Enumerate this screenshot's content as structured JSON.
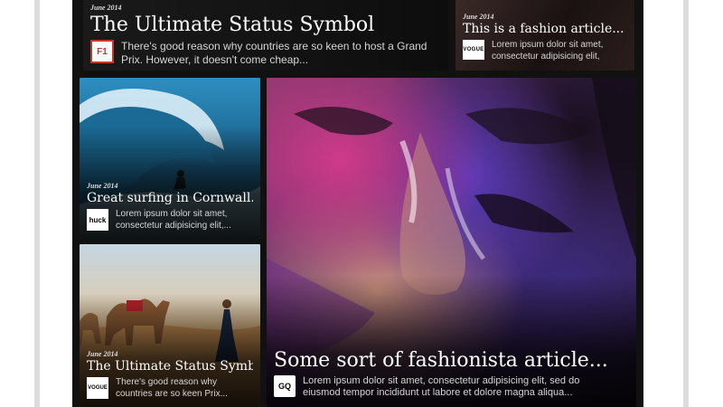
{
  "cards": [
    {
      "id": "c1",
      "date": "June 2014",
      "title": "The Ultimate Status Symbol",
      "snippet_lines": [
        "There's good reason why countries are so keen to host a Grand",
        "Prix. However, it doesn't come cheap..."
      ],
      "logo": "F1"
    },
    {
      "id": "c2",
      "date": "June 2014",
      "title": "This is a fashion article...",
      "snippet_lines": [
        "Lorem ipsum dolor sit amet,",
        "consectetur adipisicing elit,"
      ],
      "logo": "VOGUE"
    },
    {
      "id": "c3",
      "date": "June 2014",
      "title": "Great surfing in Cornwall...",
      "snippet_lines": [
        "Lorem ipsum dolor sit amet,",
        "consectetur adipisicing elit,..."
      ],
      "logo": "huck"
    },
    {
      "id": "c4",
      "date": "June 2014",
      "title": "The Ultimate Status Symbol...",
      "snippet_lines": [
        "There's good reason why",
        "countries are so keen Prix..."
      ],
      "logo": "VOGUE"
    },
    {
      "id": "c5",
      "title": "Some sort of fashionista article...",
      "snippet_lines": [
        "Lorem ipsum dolor sit amet, consectetur adipisicing elit, sed do",
        "eiusmod tempor incididunt ut labore et dolore magna aliqua..."
      ],
      "logo": "GQ"
    }
  ]
}
